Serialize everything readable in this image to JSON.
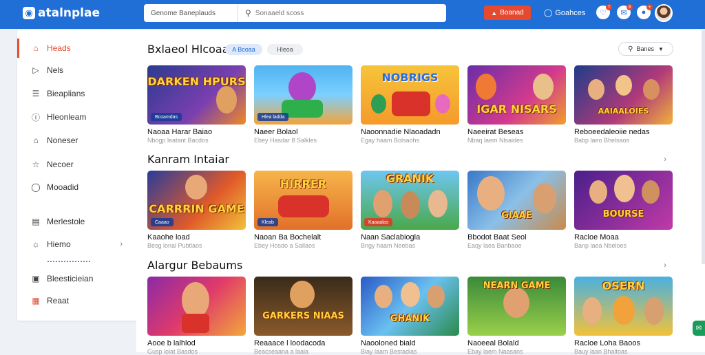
{
  "app": {
    "logo_text": "atalnplae",
    "logo_icon": "controller-icon"
  },
  "search": {
    "scope": "Genome Baneplauds",
    "placeholder": "Sonaaeld scoss",
    "icon": "search-icon"
  },
  "header": {
    "cta_label": "Boanad",
    "nav_link": "Goahces",
    "notifications": [
      "7",
      "8",
      "+"
    ]
  },
  "sidebar": {
    "items": [
      {
        "label": "Heads",
        "icon": "home-icon",
        "active": true
      },
      {
        "label": "Nels",
        "icon": "play-icon"
      },
      {
        "label": "Bieaplians",
        "icon": "list-icon"
      },
      {
        "label": "Hleonleam",
        "icon": "info-icon"
      },
      {
        "label": "Noneser",
        "icon": "house-icon"
      },
      {
        "label": "Necoer",
        "icon": "star-icon"
      },
      {
        "label": "Mooadid",
        "icon": "chat-icon"
      },
      {
        "label": "Merlestole",
        "icon": "bookmark-icon"
      },
      {
        "label": "Hiemo",
        "icon": "globe-icon"
      },
      {
        "label": "Bleesticieian",
        "icon": "settings-icon"
      },
      {
        "label": "Reaat",
        "icon": "gift-icon"
      }
    ]
  },
  "sections": [
    {
      "title": "Bxlaeol Hlcoaa",
      "tags": [
        "A Bcoaa",
        "Hleoa"
      ],
      "sort_label": "Banes",
      "cards": [
        {
          "art": "DARKEN HPURS",
          "badge": "Bcoamdas",
          "title": "Naoaa Harar Baiao",
          "sub": "Nbogp leatant Bacdos"
        },
        {
          "art": "",
          "badge": "Hlea ladda",
          "title": "Naeer Bolaol",
          "sub": "Ebey Hasdar 8 Salkles"
        },
        {
          "art": "NOBRIGS",
          "badge": "",
          "title": "Naoonnadie Nlaoadadn",
          "sub": "Egay haam Bolsaohs"
        },
        {
          "art": "IGAR NISARS",
          "badge": "",
          "title": "Naeeirat Beseas",
          "sub": "Nbaq laem Nlsaides"
        },
        {
          "art": "AAIAALOIES",
          "badge": "",
          "title": "Reboeedaleoiie nedas",
          "sub": "Babp laeo Bhelsaos"
        }
      ]
    },
    {
      "title": "Kanram Intaiar",
      "cards": [
        {
          "art": "CARRRIN GAME",
          "badge": "Caaao",
          "title": "Kaaohe load",
          "sub": "Besg lonal Pubtlaos"
        },
        {
          "art": "HIRRER",
          "badge": "Kleab",
          "title": "Naoan Ba Bochelalt",
          "sub": "Ebey Hosdo a Sallaos"
        },
        {
          "art": "GRANIK",
          "badge": "Kaaaalas",
          "title": "Naan Saclabiogla",
          "sub": "Bngy haam Neebas"
        },
        {
          "art": "GIAAE",
          "badge": "",
          "title": "Bbodot Baat Seol",
          "sub": "Eaqy laea Banbaoe"
        },
        {
          "art": "BOURSE",
          "badge": "",
          "title": "Racloe Moaa",
          "sub": "Banp laea Nbeloes"
        }
      ]
    },
    {
      "title": "Alargur Bebaums",
      "cards": [
        {
          "art": "",
          "badge": "",
          "title": "Aooe b lalhlod",
          "sub": "Gusp lolat Basdos"
        },
        {
          "art": "GARKERS NIAAS",
          "badge": "",
          "title": "Reaaace l loodacoda",
          "sub": "Beacseaana a laala"
        },
        {
          "art": "GHANIK",
          "badge": "",
          "title": "Naooloned biald",
          "sub": "Biay laam Bestadias"
        },
        {
          "art": "NEARN GAME",
          "badge": "",
          "title": "Naoeeal Bolald",
          "sub": "Ebay laem Naasans"
        },
        {
          "art": "OSERN",
          "badge": "",
          "title": "Racloe Loha Baoos",
          "sub": "Bauy laan Bhaltoas"
        }
      ]
    }
  ],
  "colors": {
    "brand": "#1f6fd6",
    "accent": "#e5492f",
    "chat": "#1a9c5b"
  }
}
